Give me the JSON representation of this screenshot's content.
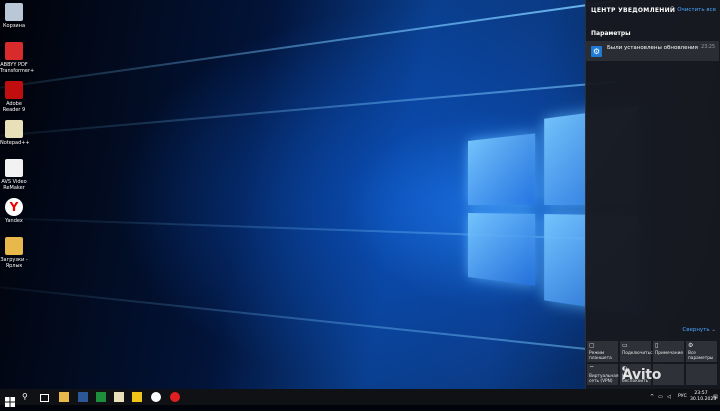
{
  "desktop": {
    "icons": [
      {
        "name": "recycle-bin",
        "label": "Корзина",
        "color": "#b9c7d6"
      },
      {
        "name": "abbyy-pdf-transformer",
        "label": "ABBYY PDF\nTransformer+",
        "color": "#d92b2b"
      },
      {
        "name": "adobe-reader",
        "label": "Adobe\nReader 9",
        "color": "#c00d0d"
      },
      {
        "name": "notepad-plus-plus",
        "label": "Notepad++",
        "color": "#e8e0b8"
      },
      {
        "name": "avs-video-remaker",
        "label": "AVS Video\nReMaker",
        "color": "#f2f2f2"
      },
      {
        "name": "yandex",
        "label": "Yandex",
        "color": "#ffffff"
      },
      {
        "name": "downloads-shortcut",
        "label": "Загрузки -\nЯрлык",
        "color": "#e8b84a"
      }
    ]
  },
  "action_center": {
    "title": "ЦЕНТР УВЕДОМЛЕНИЙ",
    "clear_all": "Очистить все",
    "group": "Параметры",
    "notification": {
      "text": "Были установлены обновления",
      "time": "23:25"
    },
    "collapse": "Свернуть ⌄",
    "tiles": [
      {
        "icon": "▢",
        "label": "Режим\nпланшета"
      },
      {
        "icon": "▭",
        "label": "Подключиться"
      },
      {
        "icon": "▯",
        "label": "Примечание"
      },
      {
        "icon": "⚙",
        "label": "Все\nпараметры"
      },
      {
        "icon": "⌔",
        "label": "Виртуальная\nсеть (VPN)"
      },
      {
        "icon": "◐",
        "label": "Не\nбеспокоить"
      },
      {
        "icon": "",
        "label": ""
      },
      {
        "icon": "",
        "label": ""
      }
    ]
  },
  "watermark": "Avito",
  "taskbar": {
    "lang": "РУС",
    "time": "23:57",
    "date": "30.10.2023"
  },
  "colors": {
    "accent": "#1f7ad6",
    "link": "#4aa7ff",
    "panel": "#17191f",
    "taskbar": "#101114"
  }
}
